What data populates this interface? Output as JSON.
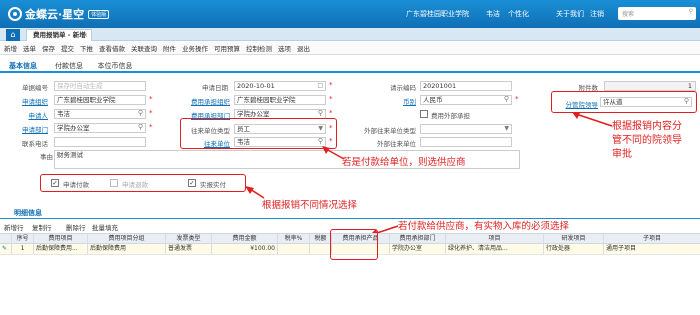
{
  "app": {
    "name": "金蝶云·星空",
    "badge": "体验版"
  },
  "topnav": {
    "org": "广东碧桂园职业学院",
    "user": "韦洁",
    "personalize": "个性化",
    "about": "关于我们",
    "logout": "注销",
    "search_placeholder": "搜索"
  },
  "tabs": {
    "bill_tab": "费用报销单 - 新增"
  },
  "toolbar": [
    "新增",
    "选单",
    "保存",
    "提交",
    "下推",
    "查看借款",
    "关联查询",
    "附件",
    "业务操作",
    "可用预算",
    "控制检测",
    "选项",
    "退出"
  ],
  "section_tabs": [
    "基本信息",
    "付款信息",
    "本位币信息"
  ],
  "form": {
    "bill_no_label": "单据编号",
    "bill_no_placeholder": "保存时自动生成",
    "apply_org_label": "申请组织",
    "apply_org": "广东碧桂园职业学院",
    "applicant_label": "申请人",
    "applicant": "韦洁",
    "apply_dept_label": "申请部门",
    "apply_dept": "学院办公室",
    "phone_label": "联系电话",
    "phone": "",
    "reason_label": "事由",
    "reason": "财务测试",
    "apply_date_label": "申请日期",
    "apply_date": "2020-10-01",
    "expense_org_label": "费用承担组织",
    "expense_org": "广东碧桂园职业学院",
    "expense_dept_label": "费用承担部门",
    "expense_dept": "学院办公室",
    "contact_type_label": "往来单位类型",
    "contact_type": "员工",
    "contact_unit_label": "往来单位",
    "contact_unit": "韦洁",
    "budget_project_label": "请示编码",
    "budget_project": "20201001",
    "currency_label": "币别",
    "currency": "人民币",
    "external_label": "费用外部承担",
    "external_contact_type_label": "外部往来单位类型",
    "external_contact_label": "外部往来单位",
    "attachments_label": "附件数",
    "attachments": "1",
    "leader_label": "分管院领导",
    "leader": "许从道"
  },
  "checkboxes": {
    "apply_payment": "申请付款",
    "apply_return": "申请退款",
    "actual_pay": "实报实付"
  },
  "annotations": {
    "leader_note": "根据报销内容分\n管不同的院领导\n审批",
    "supplier_note": "若是付款给单位，则选供应商",
    "situation_note": "根据报销不同情况选择",
    "inventory_note": "若付款给供应商，有实物入库的必须选择"
  },
  "detail": {
    "title": "明细信息",
    "toolbar": [
      "新增行",
      "复制行",
      "删除行",
      "批量填充"
    ],
    "columns": [
      "序号",
      "费用项目",
      "费用项目分组",
      "发票类型",
      "费用金额",
      "税率%",
      "税额",
      "费用承担产品",
      "费用承担部门",
      "项目",
      "研发项目",
      "子项目"
    ],
    "rows": [
      {
        "seq": "1",
        "item": "后勤保障费用...",
        "group": "后勤保障费用",
        "invoice": "普通发票",
        "amount": "¥100.00",
        "tax_rate": "",
        "tax": "",
        "product": "",
        "dept": "学院办公室",
        "project": "绿化养护、清洁用品...",
        "rd": "行政处器",
        "sub": "通用子项目"
      }
    ]
  },
  "colors": {
    "accent": "#1a8fd6",
    "annotation": "#e02020"
  }
}
